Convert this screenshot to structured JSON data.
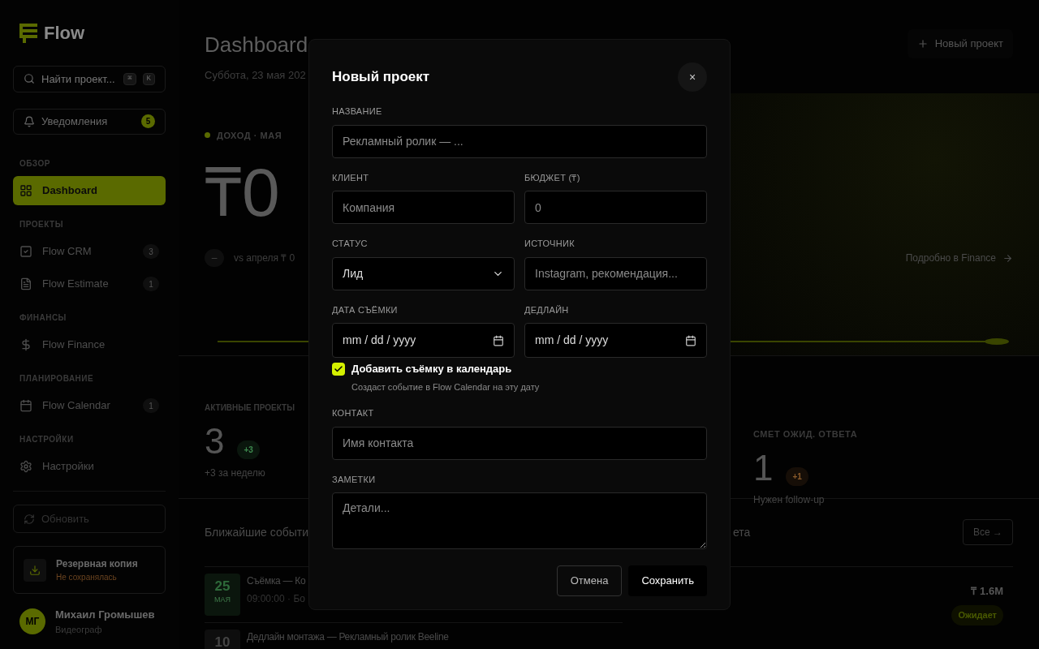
{
  "sidebar": {
    "brand": "Flow",
    "search": {
      "placeholder": "Найти проект...",
      "keys": [
        "⌘",
        "K"
      ]
    },
    "notifications": {
      "label": "Уведомления",
      "count": "5"
    },
    "sections": [
      {
        "title": "ОБЗОР",
        "items": [
          {
            "label": "Dashboard",
            "selected": true
          }
        ]
      },
      {
        "title": "ПРОЕКТЫ",
        "items": [
          {
            "label": "Flow CRM",
            "count": "3",
            "selected": false
          },
          {
            "label": "Flow Estimate",
            "count": "1",
            "selected": false
          }
        ]
      },
      {
        "title": "ФИНАНСЫ",
        "items": [
          {
            "label": "Flow Finance",
            "selected": false
          }
        ]
      },
      {
        "title": "ПЛАНИРОВАНИЕ",
        "items": [
          {
            "label": "Flow Calendar",
            "count": "1",
            "selected": false
          }
        ]
      },
      {
        "title": "НАСТРОЙКИ",
        "items": [
          {
            "label": "Настройки",
            "selected": false
          }
        ]
      }
    ],
    "refresh": {
      "label": "Обновить",
      "disabled": true
    },
    "backup": {
      "title": "Резервная копия",
      "status": "Не сохранялась"
    },
    "user": {
      "initials": "МГ",
      "name": "Михаил Громышев",
      "role": "Видеограф"
    }
  },
  "header": {
    "title": "Dashboard",
    "date": "Суббота, 23 мая 202",
    "new_button": "Новый проект"
  },
  "revenue": {
    "label": "ДОХОД · МАЯ",
    "value": "₸0",
    "delta": "–",
    "compare": "vs апреля ₸ 0",
    "link": "Подробно в Finance"
  },
  "stats": [
    {
      "label": "АКТИВНЫЕ ПРОЕКТЫ",
      "value": "3",
      "badge": "+3",
      "color": "#3e8a4f",
      "note": "+3 за неделю"
    },
    {
      "label": "СМЕТ ОЖИД. ОТВЕТА",
      "value": "1",
      "badge": "+1",
      "color": "#8a5a2a",
      "note": "Нужен follow-up"
    }
  ],
  "events": {
    "title": "Ближайшие событи",
    "items": [
      {
        "day": "25",
        "month": "МАЯ",
        "title": "Съёмка — Ко",
        "meta": "09:00:00 · Бо",
        "highlight": true
      },
      {
        "day": "10",
        "title": "Дедлайн монтажа — Рекламный ролик Beeline",
        "highlight": false
      }
    ]
  },
  "estimates": {
    "title": "ета",
    "all_button": "Все →",
    "amount": "₸ 1.6M",
    "status": "Ожидает"
  },
  "modal": {
    "title": "Новый проект",
    "close": "×",
    "fields": [
      {
        "label": "НАЗВАНИЕ",
        "kind": "text",
        "placeholder": "Рекламный ролик — ..."
      },
      {
        "label": "КЛИЕНТ",
        "kind": "text",
        "placeholder": "Компания"
      },
      {
        "label": "БЮДЖЕТ (₸)",
        "kind": "text",
        "placeholder": "0"
      },
      {
        "label": "СТАТУС",
        "kind": "select",
        "value": "Лид"
      },
      {
        "label": "ИСТОЧНИК",
        "kind": "text",
        "placeholder": "Instagram, рекомендация..."
      },
      {
        "label": "ДАТА СЪЁМКИ",
        "kind": "date",
        "placeholder": "mm / dd / yyyy"
      },
      {
        "label": "ДЕДЛАЙН",
        "kind": "date",
        "placeholder": "mm / dd / yyyy"
      }
    ],
    "calendar_option": {
      "label": "Добавить съёмку в календарь",
      "hint": "Создаст событие в Flow Calendar на эту дату",
      "checked": true
    },
    "contact": {
      "label": "КОНТАКТ",
      "placeholder": "Имя контакта"
    },
    "notes": {
      "label": "ЗАМЕТКИ",
      "placeholder": "Детали..."
    },
    "cancel": "Отмена",
    "save": "Сохранить"
  }
}
